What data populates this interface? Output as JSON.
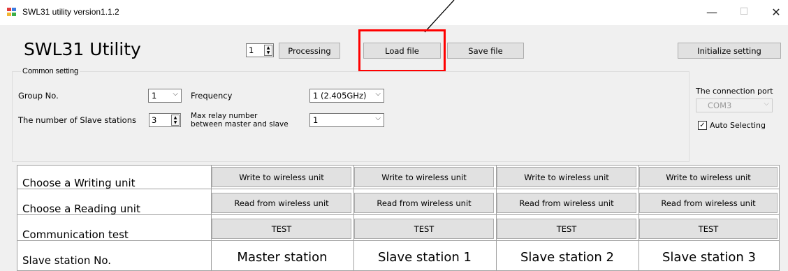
{
  "window": {
    "title": "SWL31 utility version1.1.2",
    "min_symbol": "—",
    "max_symbol": "☐",
    "close_symbol": "✕"
  },
  "header": {
    "app_title": "SWL31 Utility",
    "spin_value": "1",
    "processing_label": "Processing",
    "load_label": "Load file",
    "save_label": "Save file",
    "initialize_label": "Initialize setting"
  },
  "common": {
    "group_title": "Common setting",
    "group_no_label": "Group No.",
    "group_no_value": "1",
    "frequency_label": "Frequency",
    "frequency_value": "1 (2.405GHz)",
    "slaves_label": "The number of Slave stations",
    "slaves_value": "3",
    "max_relay_label_1": "Max relay number",
    "max_relay_label_2": "between master and slave",
    "max_relay_value": "1",
    "port_label": "The connection port",
    "port_value": "COM3",
    "auto_select_label": "Auto Selecting",
    "auto_select_checked": true
  },
  "grid": {
    "row_labels": [
      "Choose a Writing unit",
      "Choose a Reading unit",
      "Communication test",
      "Slave station No."
    ],
    "write_label": "Write to wireless unit",
    "read_label": "Read from wireless unit",
    "test_label": "TEST",
    "stations": [
      "Master station",
      "Slave station 1",
      "Slave station 2",
      "Slave station 3"
    ]
  },
  "icons": {
    "app_icon": "app-window-icon",
    "spin_arrows": "spinner-arrows-icon",
    "chevron": "chevron-down-icon",
    "check": "checkmark-icon"
  },
  "colors": {
    "highlight": "#ff0000",
    "button_face": "#e1e1e1"
  }
}
